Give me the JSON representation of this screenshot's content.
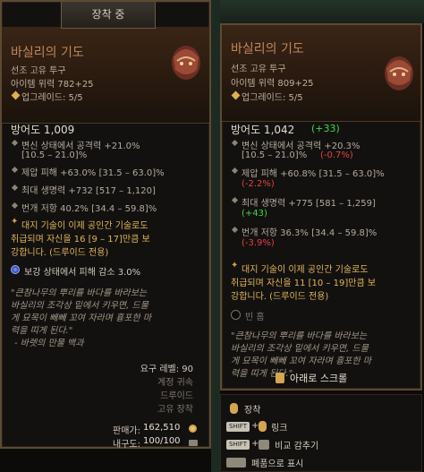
{
  "equipped_tab": "장착 중",
  "left_item": {
    "name": "바실리의 기도",
    "type": "선조 고유 투구",
    "item_power": "아이템 위력 782+25",
    "upgrades": "업그레이드: 5/5",
    "armor": "방어도 1,009",
    "affixes": [
      "변신 상태에서 공격력 +21.0%",
      "[10.5 – 21.0]%",
      "제압 피해 +63.0% [31.5 – 63.0]%",
      "최대 생명력 +732 [517 – 1,120]",
      "번개 저항 40.2% [34.4 – 59.8]%"
    ],
    "unique_power_1": "대지 기술이 이제 공인간 기술로도",
    "unique_power_2": "취급되며 자신을 16 [9 – 17]만큼 보",
    "unique_power_3": "강합니다. (드루이드 전용)",
    "aspect": "보강 상태에서 피해 감소 3.0%",
    "flavor": [
      "\"큰참나무의 뿌리를 바다를 바라보는",
      "바실리의 조각상 밑에서 키우면, 드물",
      "게 묘목이 빼빼 꼬여 자라며 흉포한 마",
      "력을 띠게 된다.\"",
      "- 바렛의 만물 백과"
    ],
    "requirements": [
      "요구 레벨: 90",
      "계정 귀속",
      "드루이드",
      "고유 장착"
    ],
    "sell_label": "판매가:",
    "sell_value": "162,510",
    "durability_label": "내구도:",
    "durability_value": "100/100"
  },
  "right_item": {
    "name": "바실리의 기도",
    "type": "선조 고유 투구",
    "item_power": "아이템 위력 809+25",
    "upgrades": "업그레이드: 5/5",
    "armor": "방어도 1,042",
    "armor_diff": "(+33)",
    "affix1": "변신 상태에서 공격력 +20.3%",
    "affix1_range": "[10.5 – 21.0]%",
    "affix1_diff": "(-0.7%)",
    "affix2": "제압 피해 +60.8% [31.5 – 63.0]%",
    "affix2_diff": "(-2.2%)",
    "affix3": "최대 생명력 +775 [581 – 1,259]",
    "affix3_diff": "(+43)",
    "affix4": "번개 저항 36.3% [34.4 – 59.8]%",
    "affix4_diff": "(-3.9%)",
    "unique_power_1": "대지 기술이 이제 공인간 기술로도",
    "unique_power_2": "취급되며 자신을 11 [10 – 19]만큼 보",
    "unique_power_3": "강합니다. (드루이드 전용)",
    "socket": "빈 홈",
    "flavor": [
      "\"큰참나무의 뿌리를 바다를 바라보는",
      "바실리의 조각상 밑에서 키우면, 드물",
      "게 묘목이 빼빼 꼬여 자라며 흉포한 마",
      "력을 띠게 된다.\""
    ]
  },
  "scroll_hint": "아래로 스크롤",
  "keybinds": [
    {
      "key": "",
      "label": "장착"
    },
    {
      "key": "SHIFT",
      "label": "링크"
    },
    {
      "key": "SHIFT",
      "label": "비교 감추기"
    },
    {
      "key": "",
      "label": "폐품으로 표시"
    }
  ],
  "colors": {
    "title": "#c1865a",
    "positive": "#3fd84a",
    "negative": "#e34141",
    "gold": "#e0b658"
  }
}
